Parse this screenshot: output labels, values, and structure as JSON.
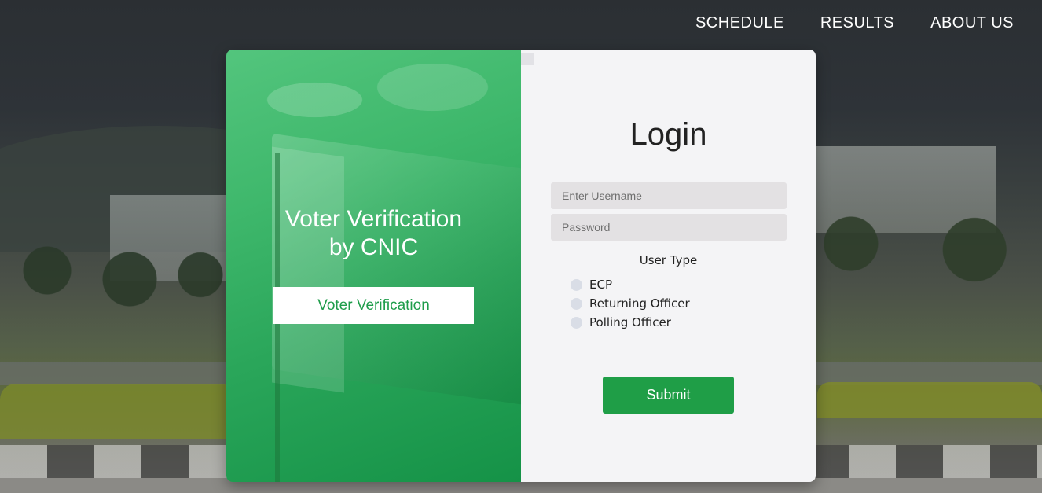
{
  "nav": {
    "items": [
      {
        "label": "SCHEDULE"
      },
      {
        "label": "RESULTS"
      },
      {
        "label": "ABOUT US"
      }
    ]
  },
  "left_panel": {
    "title_line1": "Voter Verification",
    "title_line2": "by CNIC",
    "button_label": "Voter Verification"
  },
  "login": {
    "title": "Login",
    "username_placeholder": "Enter Username",
    "password_placeholder": "Password",
    "user_type_label": "User Type",
    "user_types": [
      {
        "label": "ECP"
      },
      {
        "label": "Returning Officer"
      },
      {
        "label": "Polling Officer"
      }
    ],
    "submit_label": "Submit"
  },
  "colors": {
    "accent_green": "#1f9e47",
    "panel_green": "#3fb86c",
    "radio": "#d9dde6"
  }
}
